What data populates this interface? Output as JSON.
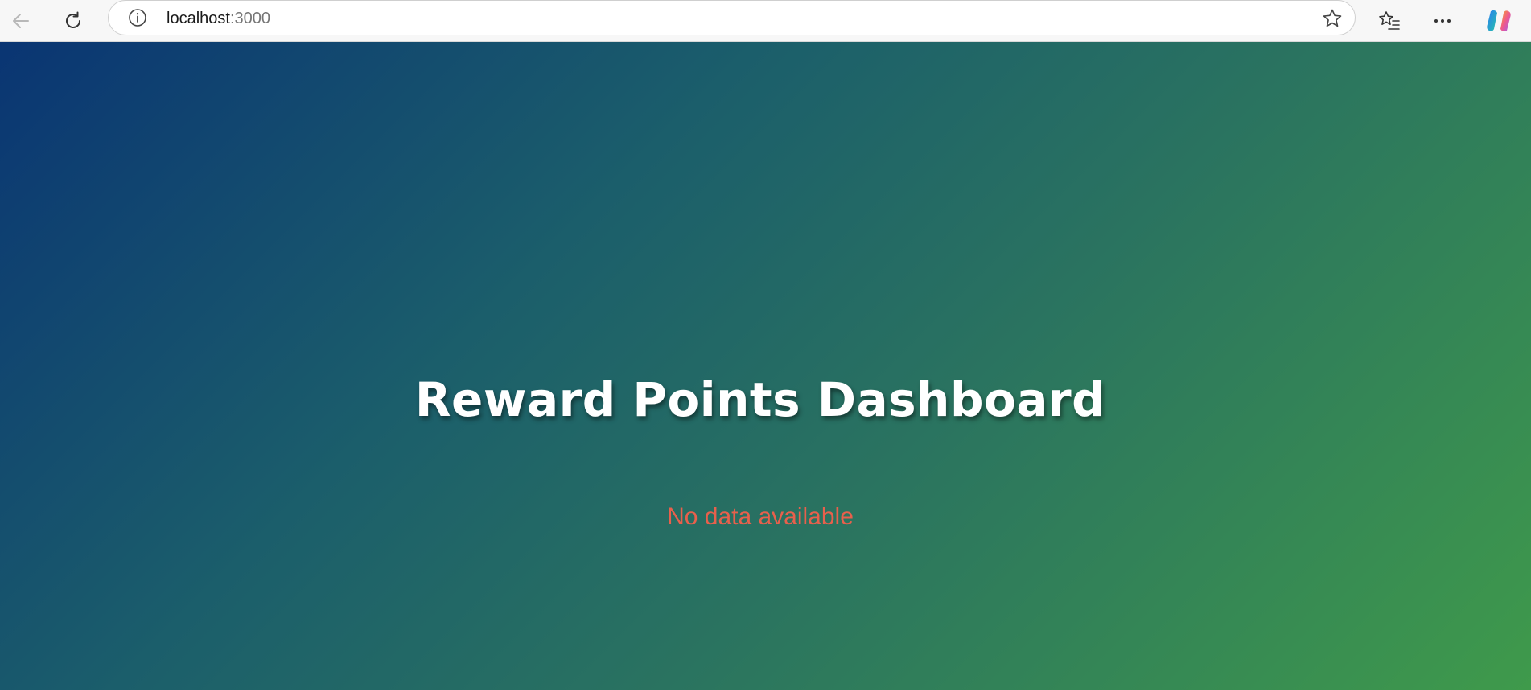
{
  "browser": {
    "url_host": "localhost",
    "url_port": ":3000",
    "icons": {
      "back": "arrow-left-icon",
      "reload": "reload-icon",
      "info": "info-icon",
      "favorite": "star-icon",
      "favorites_list": "favorites-list-icon",
      "more": "more-dots-icon",
      "copilot": "copilot-icon"
    }
  },
  "page": {
    "title": "Reward Points Dashboard",
    "status_message": "No data available",
    "colors": {
      "gradient_start": "#0a3573",
      "gradient_end": "#3f9a4b",
      "title": "#ffffff",
      "status_message": "#e8604c"
    }
  }
}
